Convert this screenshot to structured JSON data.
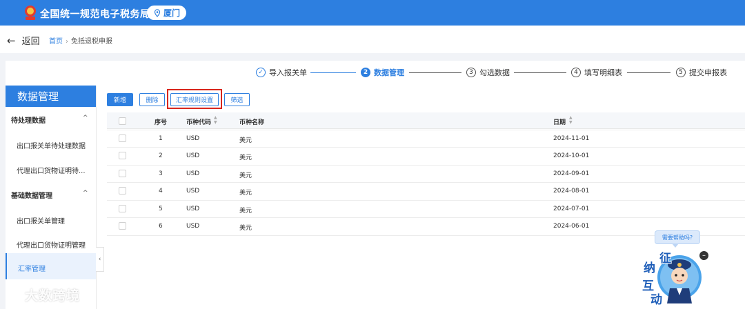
{
  "header": {
    "title": "全国统一规范电子税务局",
    "region": "厦门",
    "emblem_icon": "tax-emblem-icon",
    "region_icon": "location-pin-icon",
    "color": "#2d7fe0"
  },
  "nav": {
    "back_label": "返回",
    "breadcrumb": {
      "home": "首页",
      "current": "免抵退税申报"
    }
  },
  "steps": [
    {
      "num": "✓",
      "label": "导入报关单",
      "state": "done"
    },
    {
      "num": "2",
      "label": "数据管理",
      "state": "active"
    },
    {
      "num": "3",
      "label": "勾选数据",
      "state": "todo"
    },
    {
      "num": "4",
      "label": "填写明细表",
      "state": "todo"
    },
    {
      "num": "5",
      "label": "提交申报表",
      "state": "todo"
    }
  ],
  "sidebar": {
    "title": "数据管理",
    "groups": [
      {
        "label": "待处理数据",
        "items": [
          "出口报关单待处理数据",
          "代理出口货物证明待..."
        ]
      },
      {
        "label": "基础数据管理",
        "items": [
          "出口报关单管理",
          "代理出口货物证明管理",
          "汇率管理"
        ]
      }
    ],
    "active_item": "汇率管理",
    "collapse_icon": "chevron-left-icon"
  },
  "toolbar": {
    "add_label": "新增",
    "delete_label": "删除",
    "rate_rule_label": "汇率规则设置",
    "filter_label": "筛选"
  },
  "table": {
    "headers": {
      "index": "序号",
      "code": "币种代码",
      "name": "币种名称",
      "date": "日期"
    },
    "rows": [
      {
        "index": "1",
        "code": "USD",
        "name": "美元",
        "date": "2024-11-01"
      },
      {
        "index": "2",
        "code": "USD",
        "name": "美元",
        "date": "2024-10-01"
      },
      {
        "index": "3",
        "code": "USD",
        "name": "美元",
        "date": "2024-09-01"
      },
      {
        "index": "4",
        "code": "USD",
        "name": "美元",
        "date": "2024-08-01"
      },
      {
        "index": "5",
        "code": "USD",
        "name": "美元",
        "date": "2024-07-01"
      },
      {
        "index": "6",
        "code": "USD",
        "name": "美元",
        "date": "2024-06-01"
      }
    ]
  },
  "assistant": {
    "bubble": "需要帮助吗?",
    "chars": [
      "征",
      "纳",
      "互",
      "动"
    ]
  },
  "watermark": "大数跨境"
}
